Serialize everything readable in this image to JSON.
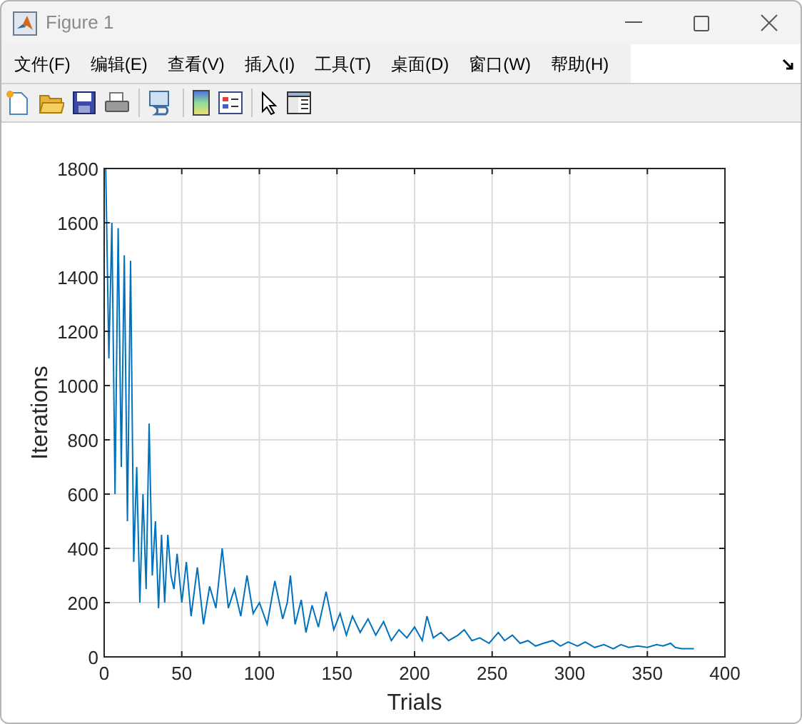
{
  "window": {
    "title": "Figure 1"
  },
  "menu": [
    "文件(F)",
    "编辑(E)",
    "查看(V)",
    "插入(I)",
    "工具(T)",
    "桌面(D)",
    "窗口(W)",
    "帮助(H)"
  ],
  "chart_data": {
    "type": "line",
    "grid": true,
    "xlabel": "Trials",
    "ylabel": "Iterations",
    "xlim": [
      0,
      400
    ],
    "ylim": [
      0,
      1800
    ],
    "xticks": [
      0,
      50,
      100,
      150,
      200,
      250,
      300,
      350,
      400
    ],
    "yticks": [
      0,
      200,
      400,
      600,
      800,
      1000,
      1200,
      1400,
      1600,
      1800
    ],
    "x": [
      1,
      3,
      5,
      7,
      9,
      11,
      13,
      15,
      17,
      19,
      21,
      23,
      25,
      27,
      29,
      31,
      33,
      35,
      37,
      39,
      41,
      43,
      45,
      47,
      50,
      53,
      56,
      60,
      64,
      68,
      72,
      76,
      80,
      84,
      88,
      92,
      96,
      100,
      105,
      110,
      115,
      118,
      120,
      123,
      127,
      130,
      134,
      138,
      143,
      148,
      152,
      156,
      160,
      165,
      170,
      175,
      180,
      185,
      190,
      195,
      200,
      205,
      208,
      212,
      217,
      222,
      228,
      232,
      237,
      242,
      248,
      254,
      258,
      263,
      268,
      273,
      278,
      283,
      289,
      294,
      299,
      305,
      310,
      316,
      322,
      328,
      333,
      338,
      344,
      350,
      356,
      360,
      365,
      368,
      372,
      380
    ],
    "series": [
      {
        "color": "#0072bd",
        "values": [
          1800,
          1100,
          1600,
          600,
          1580,
          700,
          1480,
          500,
          1460,
          350,
          700,
          200,
          600,
          250,
          860,
          300,
          500,
          180,
          450,
          200,
          450,
          300,
          250,
          380,
          200,
          350,
          150,
          330,
          120,
          260,
          180,
          400,
          180,
          250,
          150,
          300,
          160,
          200,
          120,
          280,
          140,
          200,
          300,
          120,
          210,
          90,
          190,
          110,
          240,
          100,
          160,
          80,
          150,
          90,
          140,
          80,
          130,
          60,
          100,
          70,
          110,
          60,
          150,
          70,
          90,
          60,
          80,
          100,
          60,
          70,
          50,
          90,
          60,
          80,
          50,
          60,
          40,
          50,
          60,
          40,
          55,
          40,
          55,
          35,
          45,
          30,
          45,
          35,
          40,
          35,
          45,
          40,
          50,
          35,
          30,
          30
        ]
      }
    ]
  }
}
